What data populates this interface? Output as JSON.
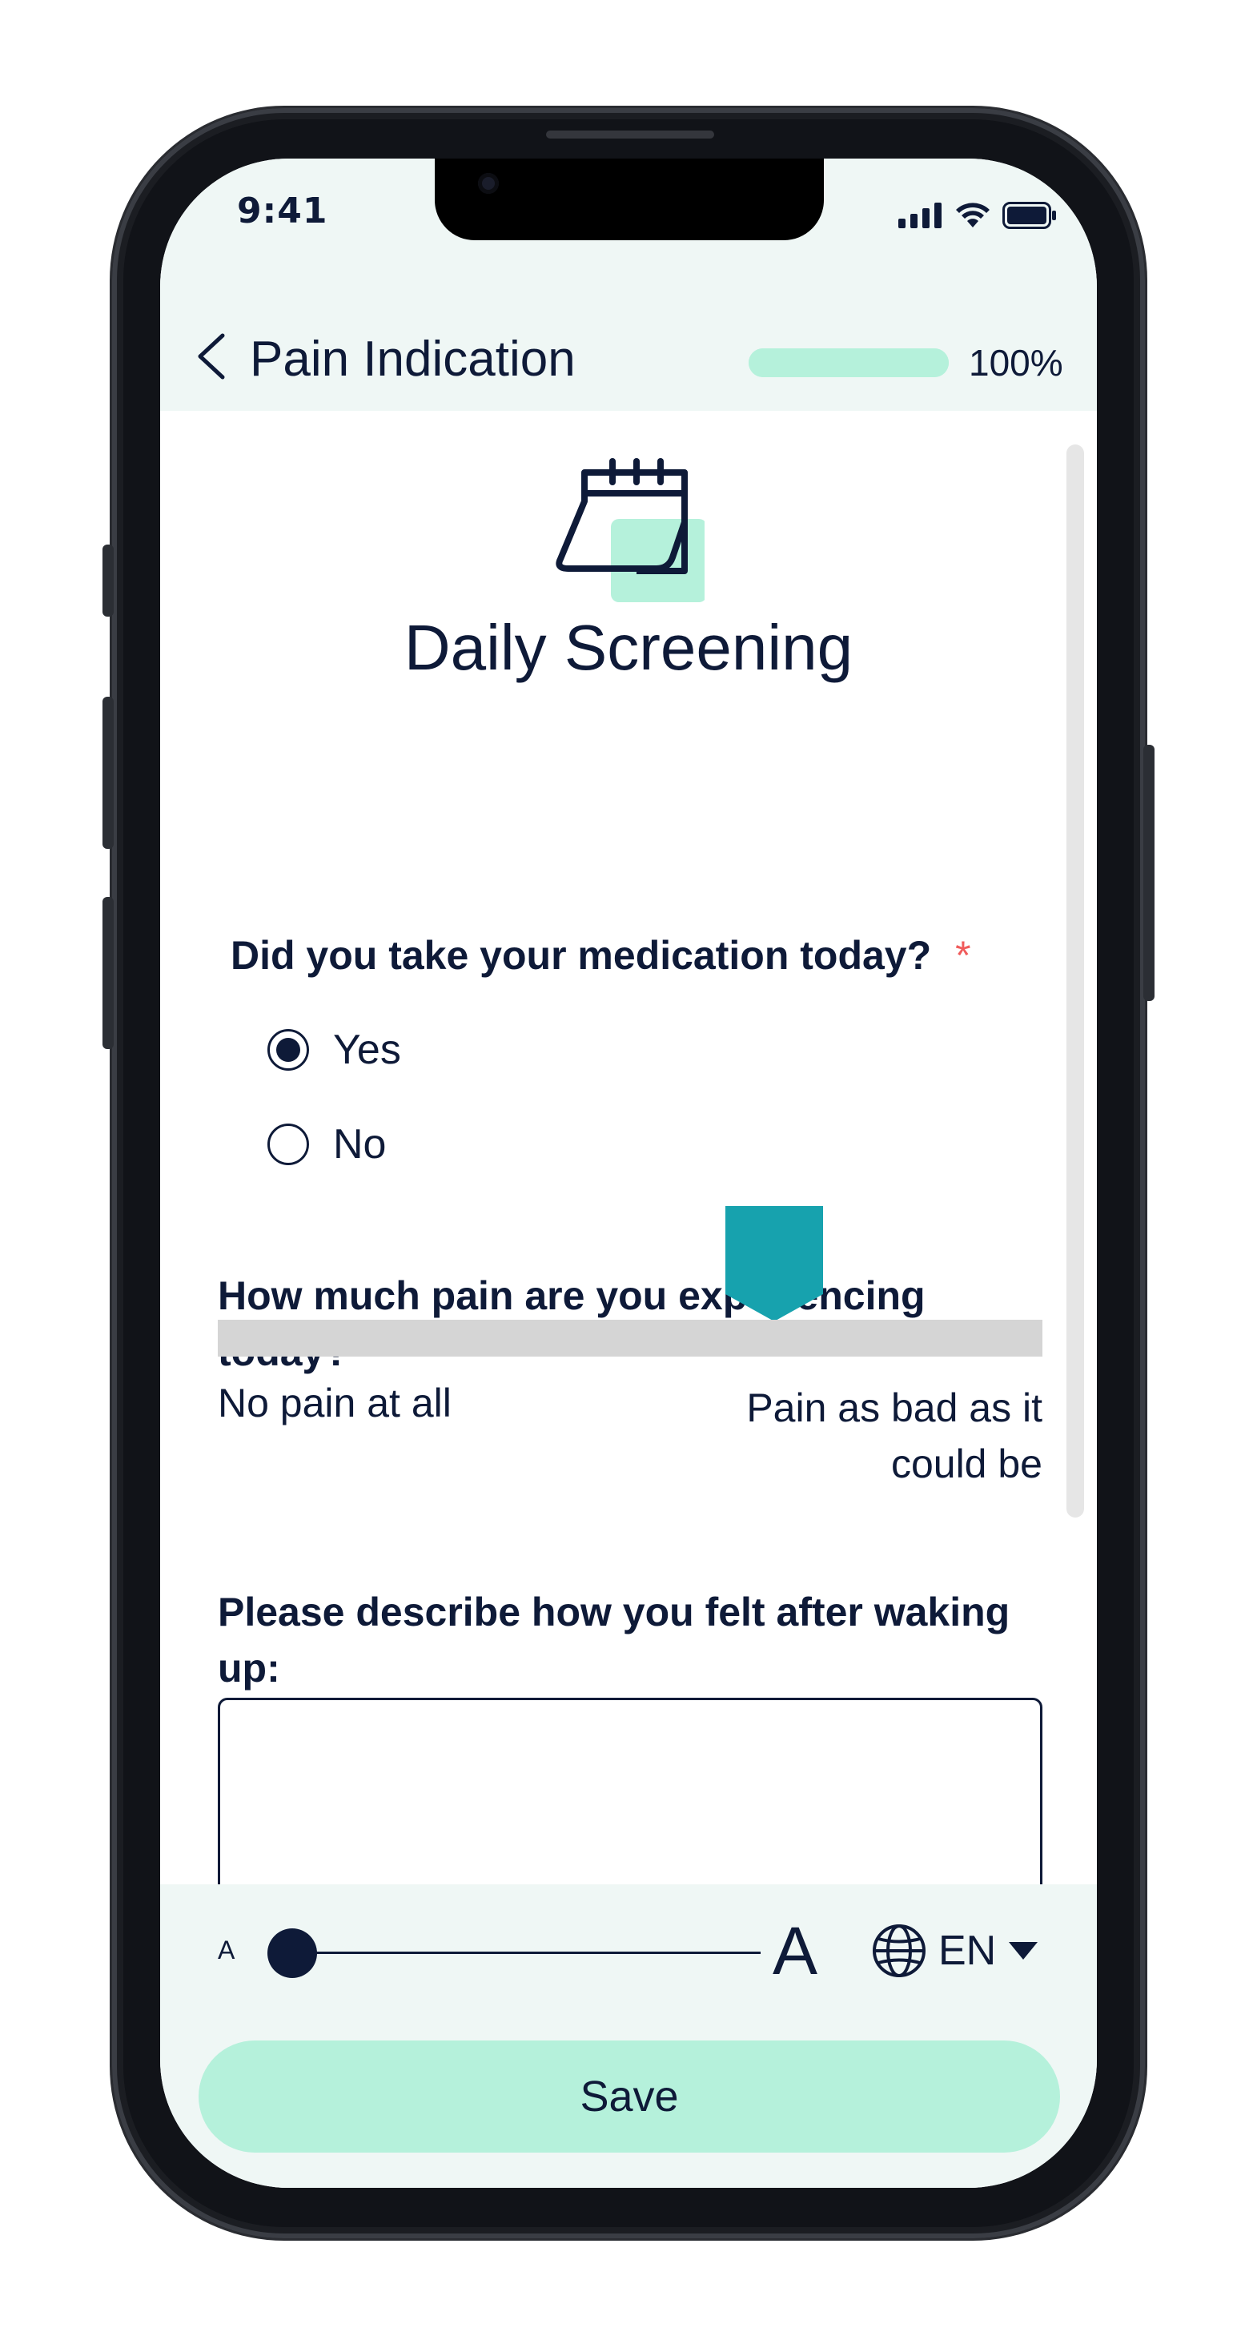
{
  "status_bar": {
    "time": "9:41",
    "icons": [
      "cellular-signal-icon",
      "wifi-icon",
      "battery-icon"
    ]
  },
  "header": {
    "back_icon": "chevron-left-icon",
    "title": "Pain Indication",
    "progress_percent": 100,
    "progress_label": "100%"
  },
  "form": {
    "icon": "calendar-icon",
    "title": "Daily Screening",
    "questions": {
      "medication": {
        "label": "Did you take your medication today?",
        "required_mark": "*",
        "options": [
          {
            "label": "Yes",
            "selected": true
          },
          {
            "label": "No",
            "selected": false
          }
        ]
      },
      "pain": {
        "label": "How much pain are you experiencing today?",
        "required_mark": "*",
        "value_fraction": 0.675,
        "min_label": "No pain at all",
        "max_label": "Pain as bad as it could be"
      },
      "waking": {
        "label": "Please describe how you felt after waking up:",
        "value": ""
      }
    }
  },
  "footer": {
    "font_size_small": "A",
    "font_size_large": "A",
    "font_size_level": 0.0,
    "language_icon": "globe-icon",
    "language": "EN",
    "language_dropdown_icon": "caret-down-icon",
    "save_label": "Save"
  },
  "colors": {
    "primary_text": "#0e1a38",
    "accent_mint": "#b5f1db",
    "slider_thumb": "#17a2ae",
    "required": "#f05b5b",
    "background_tint": "#eff7f5"
  }
}
